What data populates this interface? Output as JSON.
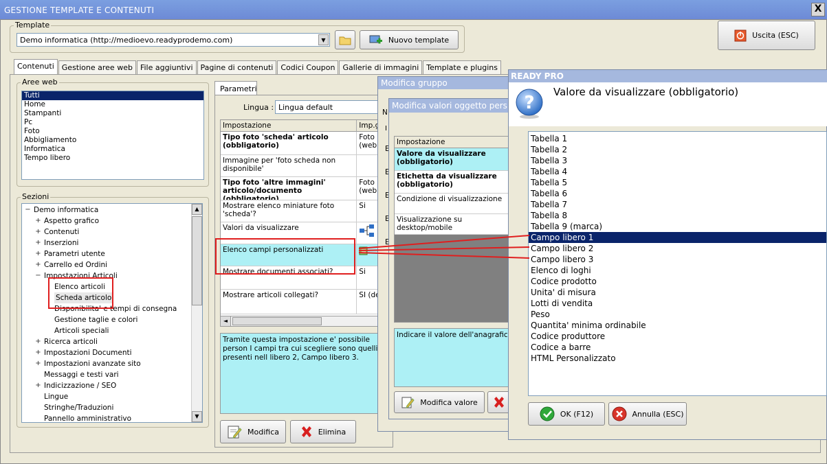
{
  "main_window": {
    "title": "GESTIONE TEMPLATE E CONTENUTI",
    "close": "X"
  },
  "template": {
    "group_label": "Template",
    "selected": "Demo informatica (http://medioevo.readyprodemo.com)",
    "new_button": "Nuovo template"
  },
  "exit_button": "Uscita (ESC)",
  "tabs": [
    "Contenuti",
    "Gestione aree web",
    "File aggiuntivi",
    "Pagine di contenuti",
    "Codici Coupon",
    "Gallerie di immagini",
    "Template e plugins"
  ],
  "aree_web": {
    "label": "Aree web",
    "items": [
      "Tutti",
      "Home",
      "Stampanti",
      "Pc",
      "Foto",
      "Abbigliamento",
      "Informatica",
      "Tempo libero"
    ],
    "selected_index": 0
  },
  "sezioni": {
    "label": "Sezioni",
    "items": [
      {
        "text": "Demo informatica",
        "level": 0,
        "toggle": "−"
      },
      {
        "text": "Aspetto grafico",
        "level": 1,
        "toggle": "+"
      },
      {
        "text": "Contenuti",
        "level": 1,
        "toggle": "+"
      },
      {
        "text": "Inserzioni",
        "level": 1,
        "toggle": "+"
      },
      {
        "text": "Parametri utente",
        "level": 1,
        "toggle": "+"
      },
      {
        "text": "Carrello ed Ordini",
        "level": 1,
        "toggle": "+"
      },
      {
        "text": "Impostazioni Articoli",
        "level": 1,
        "toggle": "−"
      },
      {
        "text": "Elenco articoli",
        "level": 2,
        "toggle": ""
      },
      {
        "text": "Scheda articolo",
        "level": 2,
        "toggle": ""
      },
      {
        "text": "Disponibilita' e tempi di consegna",
        "level": 2,
        "toggle": ""
      },
      {
        "text": "Gestione taglie e colori",
        "level": 2,
        "toggle": ""
      },
      {
        "text": "Articoli speciali",
        "level": 2,
        "toggle": ""
      },
      {
        "text": "Ricerca articoli",
        "level": 1,
        "toggle": "+"
      },
      {
        "text": "Impostazioni Documenti",
        "level": 1,
        "toggle": "+"
      },
      {
        "text": "Impostazioni avanzate sito",
        "level": 1,
        "toggle": "+"
      },
      {
        "text": "Messaggi e testi vari",
        "level": 1,
        "toggle": ""
      },
      {
        "text": "Indicizzazione / SEO",
        "level": 1,
        "toggle": "+"
      },
      {
        "text": "Lingue",
        "level": 1,
        "toggle": ""
      },
      {
        "text": "Stringhe/Traduzioni",
        "level": 1,
        "toggle": ""
      },
      {
        "text": "Pannello amministrativo",
        "level": 1,
        "toggle": ""
      }
    ]
  },
  "parametri": {
    "tab": "Parametri",
    "lingua_label": "Lingua :",
    "lingua_value": "Lingua default",
    "col_impostazione": "Impostazione",
    "col_imp": "Imp.g",
    "rows": [
      {
        "name": "Tipo foto 'scheda' articolo (obbligatorio)",
        "value": "Foto (web)",
        "bold": true
      },
      {
        "name": "Immagine per 'foto scheda non disponibile'",
        "value": "",
        "bold": false
      },
      {
        "name": "Tipo foto 'altre immagini' articolo/documento (obbligatorio)",
        "value": "Foto (web)",
        "bold": true
      },
      {
        "name": "Mostrare elenco miniature foto 'scheda'?",
        "value": "Si",
        "bold": false
      },
      {
        "name": "Valori da visualizzare",
        "value": "",
        "bold": false
      },
      {
        "name": "Elenco campi personalizzati",
        "value": "",
        "bold": false
      },
      {
        "name": "Mostrare documenti associati?",
        "value": "Si",
        "bold": false
      },
      {
        "name": "Mostrare articoli collegati?",
        "value": "SI (de",
        "bold": false
      }
    ],
    "description": "Tramite questa impostazione e' possibile person I campi tra cui scegliere sono quelli presenti nell libero 2, Campo libero 3.",
    "modifica": "Modifica",
    "elimina": "Elimina"
  },
  "modifica_gruppo": {
    "title": "Modifica gruppo",
    "col_short": "N",
    "row_letters": [
      "E",
      "E",
      "E",
      "E",
      "E"
    ]
  },
  "modifica_valori": {
    "title": "Modifica valori oggetto pers",
    "col": "Impostazione",
    "rows": [
      "Valore da visualizzare (obbligatorio)",
      "Etichetta da visualizzare (obbligatorio)",
      "Condizione di visualizzazione",
      "Visualizzazione su desktop/mobile"
    ],
    "description": "Indicare il valore dell'anagrafica ar",
    "button": "Modifica valore"
  },
  "ready_pro": {
    "title": "READY PRO",
    "question": "Valore da visualizzare (obbligatorio)",
    "options": [
      "Tabella 1",
      "Tabella 2",
      "Tabella 3",
      "Tabella 4",
      "Tabella 5",
      "Tabella 6",
      "Tabella 7",
      "Tabella 8",
      "Tabella 9 (marca)",
      "Campo libero 1",
      "Campo libero 2",
      "Campo libero 3",
      "Elenco di loghi",
      "Codice prodotto",
      "Unita' di misura",
      "Lotti di vendita",
      "Peso",
      "Quantita' minima ordinabile",
      "Codice produttore",
      "Codice a barre",
      "HTML Personalizzato"
    ],
    "selected_index": 9,
    "ok": "OK (F12)",
    "cancel": "Annulla (ESC)"
  },
  "colors": {
    "title_blue": "#7b9fe0",
    "selection": "#0a246a",
    "cyan": "#adf0f5",
    "highlight_red": "#e01e1e"
  }
}
